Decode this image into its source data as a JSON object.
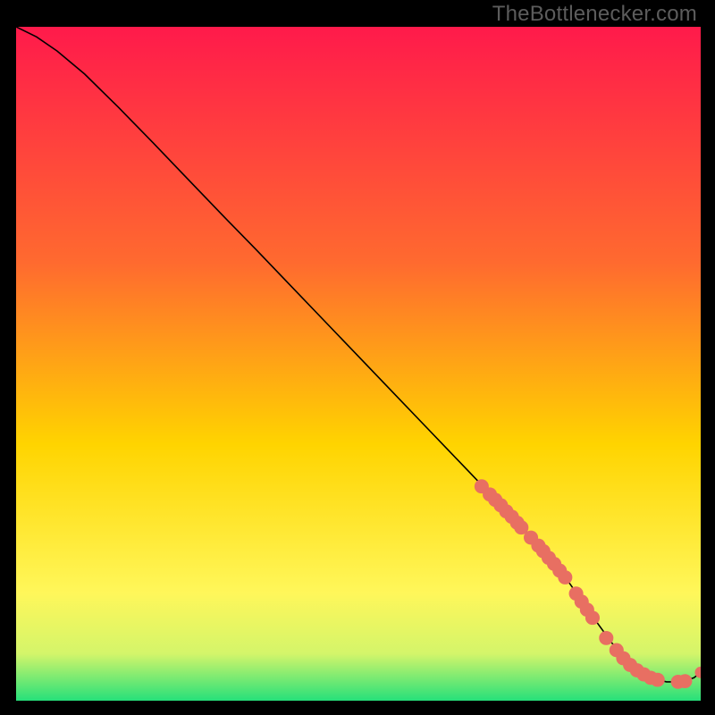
{
  "watermark": "TheBottlenecker.com",
  "colors": {
    "gradient_top": "#ff1a4b",
    "gradient_mid1": "#ff6a2f",
    "gradient_mid2": "#ffd400",
    "gradient_mid3": "#fff75a",
    "gradient_mid4": "#d4f56a",
    "gradient_bottom": "#26e07a",
    "curve": "#000000",
    "marker": "#e86f62",
    "background": "#000000"
  },
  "chart_data": {
    "type": "line",
    "title": "",
    "xlabel": "",
    "ylabel": "",
    "xlim": [
      0,
      100
    ],
    "ylim": [
      0,
      100
    ],
    "curve": {
      "x": [
        0,
        3,
        6,
        10,
        15,
        20,
        25,
        30,
        35,
        40,
        45,
        50,
        55,
        60,
        65,
        70,
        75,
        77,
        79,
        81,
        83,
        85,
        87,
        89,
        91,
        93,
        95,
        97,
        99,
        100
      ],
      "y": [
        100,
        98.5,
        96.4,
        93,
        88,
        82.8,
        77.5,
        72.2,
        67,
        61.7,
        56.4,
        51.1,
        45.8,
        40.5,
        35.2,
        29.9,
        24.6,
        22.3,
        19.9,
        17.2,
        14.3,
        11.4,
        8.6,
        6.2,
        4.4,
        3.3,
        2.8,
        2.8,
        3.4,
        4.2
      ]
    },
    "markers": [
      {
        "x": 68.0,
        "y": 31.8
      },
      {
        "x": 69.2,
        "y": 30.6
      },
      {
        "x": 70.0,
        "y": 29.8
      },
      {
        "x": 70.8,
        "y": 29.0
      },
      {
        "x": 71.6,
        "y": 28.1
      },
      {
        "x": 72.4,
        "y": 27.3
      },
      {
        "x": 73.2,
        "y": 26.4
      },
      {
        "x": 73.8,
        "y": 25.7
      },
      {
        "x": 75.2,
        "y": 24.2
      },
      {
        "x": 76.3,
        "y": 23.0
      },
      {
        "x": 77.0,
        "y": 22.2
      },
      {
        "x": 77.8,
        "y": 21.2
      },
      {
        "x": 78.6,
        "y": 20.3
      },
      {
        "x": 79.4,
        "y": 19.3
      },
      {
        "x": 80.2,
        "y": 18.3
      },
      {
        "x": 81.8,
        "y": 15.9
      },
      {
        "x": 82.6,
        "y": 14.7
      },
      {
        "x": 83.4,
        "y": 13.5
      },
      {
        "x": 84.2,
        "y": 12.3
      },
      {
        "x": 86.2,
        "y": 9.3
      },
      {
        "x": 87.7,
        "y": 7.5
      },
      {
        "x": 88.7,
        "y": 6.3
      },
      {
        "x": 89.7,
        "y": 5.3
      },
      {
        "x": 90.7,
        "y": 4.5
      },
      {
        "x": 91.7,
        "y": 3.9
      },
      {
        "x": 92.7,
        "y": 3.4
      },
      {
        "x": 93.7,
        "y": 3.1
      },
      {
        "x": 96.7,
        "y": 2.8
      },
      {
        "x": 97.7,
        "y": 2.9
      },
      {
        "x": 100.0,
        "y": 4.2
      }
    ]
  }
}
